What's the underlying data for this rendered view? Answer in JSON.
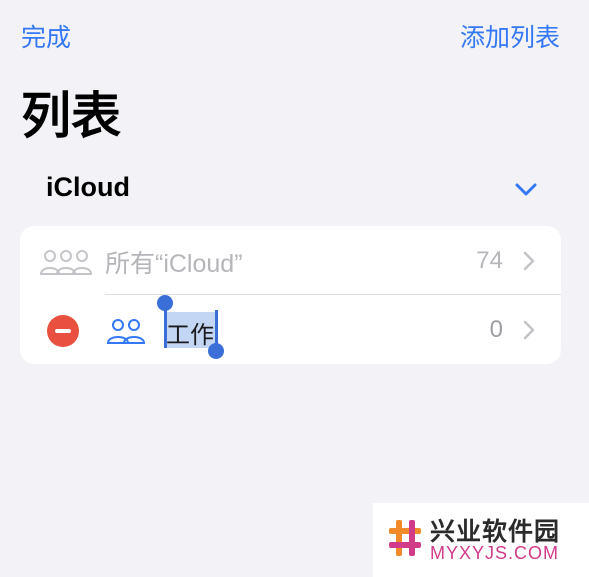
{
  "nav": {
    "done_label": "完成",
    "add_list_label": "添加列表"
  },
  "page": {
    "title": "列表"
  },
  "section": {
    "account": "iCloud",
    "expand_icon": "chevron-down-icon"
  },
  "lists": [
    {
      "name": "所有“iCloud”",
      "count": "74",
      "icon": "people-group-icon"
    },
    {
      "name": "工作",
      "count": "0",
      "icon": "people-icon",
      "selected_text": "工作"
    }
  ],
  "watermark": {
    "title": "兴业软件园",
    "subtitle": "MYXYJS.COM"
  },
  "colors": {
    "accent": "#3478f6",
    "delete": "#e9503f",
    "background": "#f2f2f7",
    "watermark_pink": "#d23a8a",
    "watermark_orange": "#f08a2a"
  }
}
